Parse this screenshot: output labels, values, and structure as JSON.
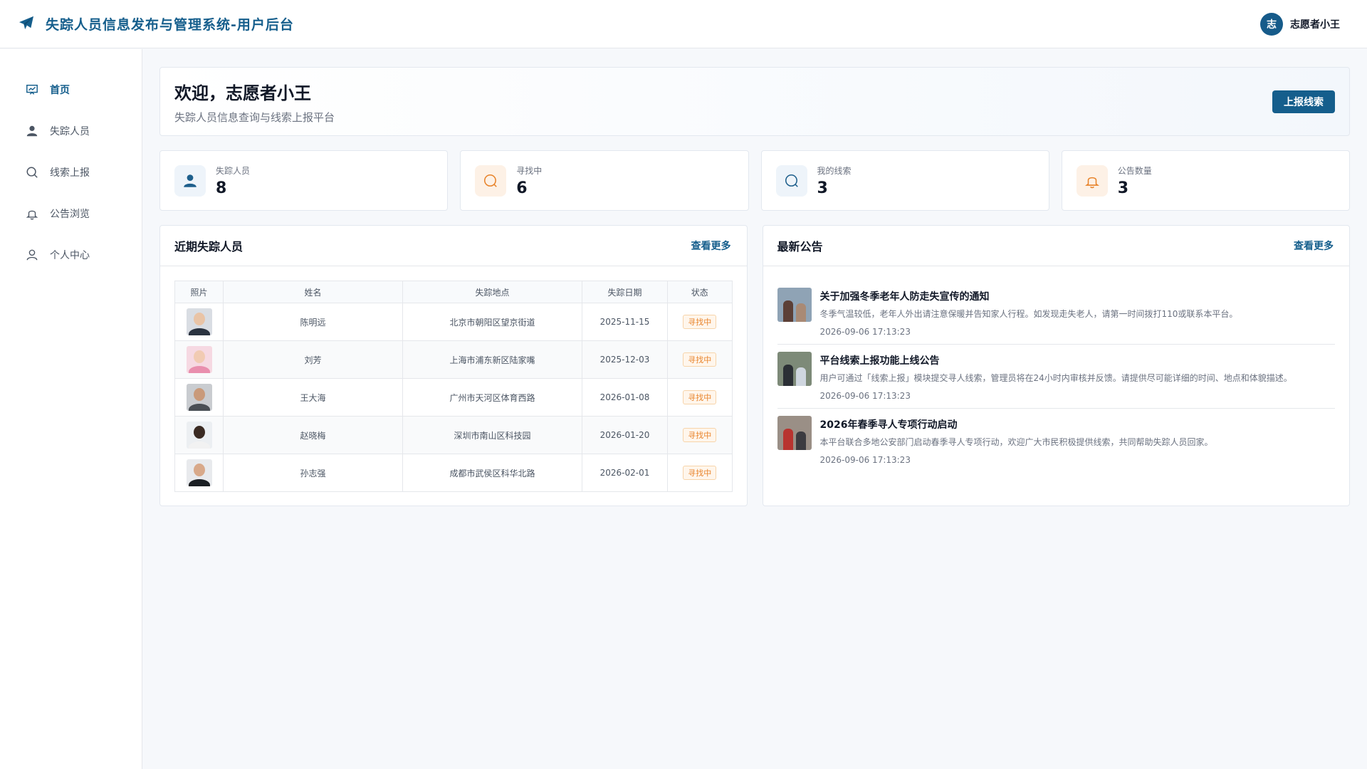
{
  "header": {
    "title": "失踪人员信息发布与管理系统-用户后台",
    "avatar_char": "志",
    "user_name": "志愿者小王"
  },
  "sidebar": {
    "items": [
      {
        "label": "首页",
        "icon": "dashboard-icon",
        "active": true
      },
      {
        "label": "失踪人员",
        "icon": "person-icon"
      },
      {
        "label": "线索上报",
        "icon": "search-icon"
      },
      {
        "label": "公告浏览",
        "icon": "bell-icon"
      },
      {
        "label": "个人中心",
        "icon": "user-outline-icon"
      }
    ]
  },
  "welcome": {
    "title": "欢迎，志愿者小王",
    "subtitle": "失踪人员信息查询与线索上报平台",
    "button": "上报线索"
  },
  "stats": [
    {
      "label": "失踪人员",
      "value": "8",
      "icon": "person-icon",
      "color": "#1e5f8c"
    },
    {
      "label": "寻找中",
      "value": "6",
      "icon": "search-icon",
      "color": "#e8832a"
    },
    {
      "label": "我的线索",
      "value": "3",
      "icon": "search-icon",
      "color": "#1e5f8c"
    },
    {
      "label": "公告数量",
      "value": "3",
      "icon": "bell-icon",
      "color": "#e8832a"
    }
  ],
  "recent": {
    "title": "近期失踪人员",
    "more": "查看更多",
    "columns": [
      "照片",
      "姓名",
      "失踪地点",
      "失踪日期",
      "状态"
    ],
    "rows": [
      {
        "name": "陈明远",
        "place": "北京市朝阳区望京街道",
        "date": "2025-11-15",
        "status": "寻找中"
      },
      {
        "name": "刘芳",
        "place": "上海市浦东新区陆家嘴",
        "date": "2025-12-03",
        "status": "寻找中"
      },
      {
        "name": "王大海",
        "place": "广州市天河区体育西路",
        "date": "2026-01-08",
        "status": "寻找中"
      },
      {
        "name": "赵晓梅",
        "place": "深圳市南山区科技园",
        "date": "2026-01-20",
        "status": "寻找中"
      },
      {
        "name": "孙志强",
        "place": "成都市武侯区科华北路",
        "date": "2026-02-01",
        "status": "寻找中"
      }
    ]
  },
  "news": {
    "title": "最新公告",
    "more": "查看更多",
    "items": [
      {
        "title": "关于加强冬季老年人防走失宣传的通知",
        "desc": "冬季气温较低，老年人外出请注意保暖并告知家人行程。如发现走失老人，请第一时间拨打110或联系本平台。",
        "time": "2026-09-06 17:13:23"
      },
      {
        "title": "平台线索上报功能上线公告",
        "desc": "用户可通过「线索上报」模块提交寻人线索，管理员将在24小时内审核并反馈。请提供尽可能详细的时间、地点和体貌描述。",
        "time": "2026-09-06 17:13:23"
      },
      {
        "title": "2026年春季寻人专项行动启动",
        "desc": "本平台联合多地公安部门启动春季寻人专项行动，欢迎广大市民积极提供线索，共同帮助失踪人员回家。",
        "time": "2026-09-06 17:13:23"
      }
    ]
  },
  "colors": {
    "primary": "#155e8c",
    "warning": "#e8832a"
  }
}
